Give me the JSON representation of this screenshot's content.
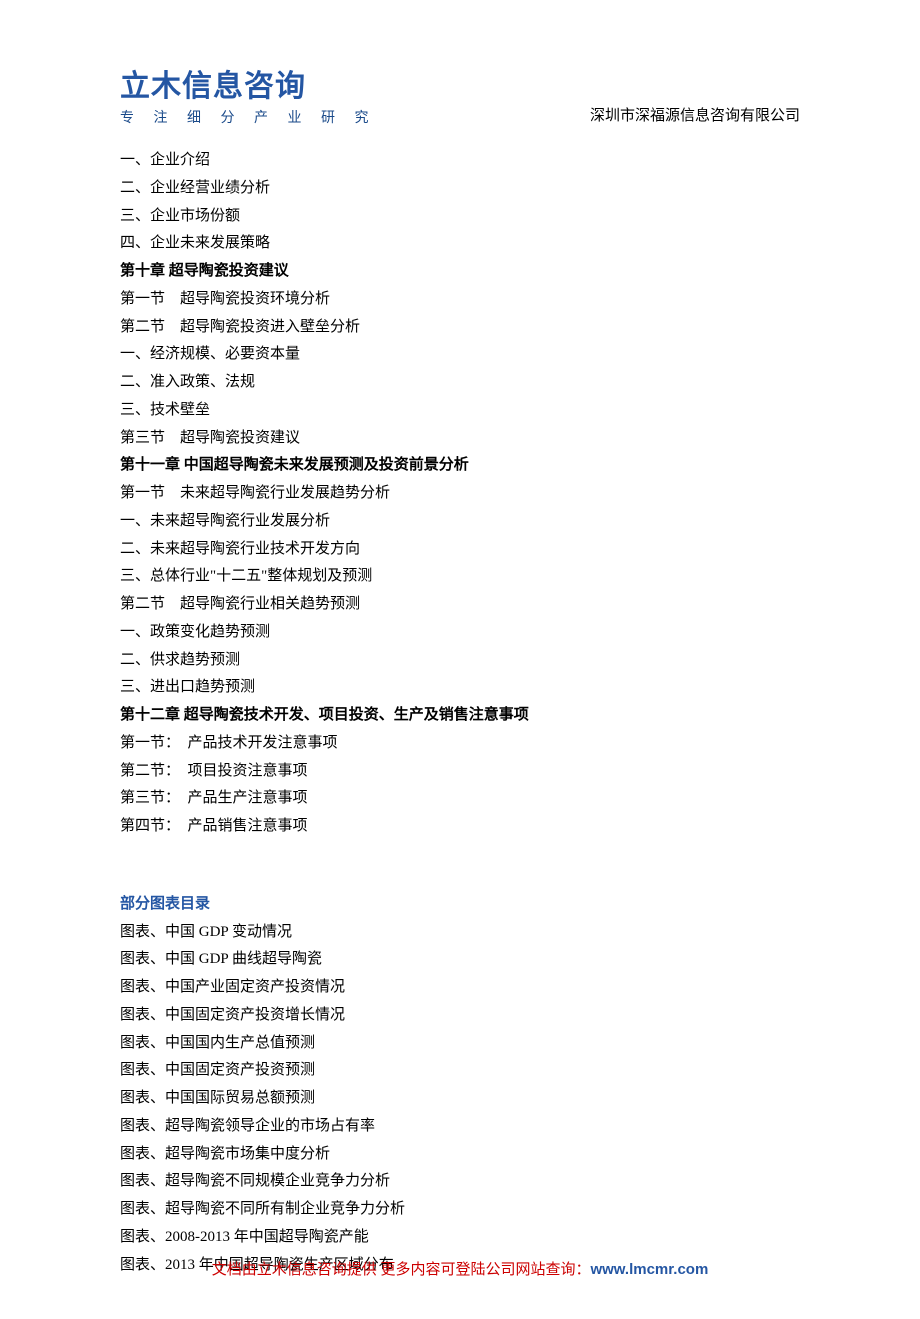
{
  "logo": {
    "main": "立木信息咨询",
    "sub": "专 注 细 分 产 业 研 究"
  },
  "company": "深圳市深福源信息咨询有限公司",
  "lines": [
    {
      "text": "一、企业介绍",
      "type": "plain"
    },
    {
      "text": "二、企业经营业绩分析",
      "type": "plain"
    },
    {
      "text": "三、企业市场份额",
      "type": "plain"
    },
    {
      "text": "四、企业未来发展策略",
      "type": "plain"
    },
    {
      "text": "第十章 超导陶瓷投资建议",
      "type": "heading"
    },
    {
      "text": "第一节　超导陶瓷投资环境分析",
      "type": "plain"
    },
    {
      "text": "第二节　超导陶瓷投资进入壁垒分析",
      "type": "plain"
    },
    {
      "text": "一、经济规模、必要资本量",
      "type": "plain"
    },
    {
      "text": "二、准入政策、法规",
      "type": "plain"
    },
    {
      "text": "三、技术壁垒",
      "type": "plain"
    },
    {
      "text": "第三节　超导陶瓷投资建议",
      "type": "plain"
    },
    {
      "text": "第十一章 中国超导陶瓷未来发展预测及投资前景分析",
      "type": "heading"
    },
    {
      "text": "第一节　未来超导陶瓷行业发展趋势分析",
      "type": "plain"
    },
    {
      "text": "一、未来超导陶瓷行业发展分析",
      "type": "plain"
    },
    {
      "text": "二、未来超导陶瓷行业技术开发方向",
      "type": "plain"
    },
    {
      "text": "三、总体行业\"十二五\"整体规划及预测",
      "type": "plain"
    },
    {
      "text": "第二节　超导陶瓷行业相关趋势预测",
      "type": "plain"
    },
    {
      "text": "一、政策变化趋势预测",
      "type": "plain"
    },
    {
      "text": "二、供求趋势预测",
      "type": "plain"
    },
    {
      "text": "三、进出口趋势预测",
      "type": "plain"
    },
    {
      "text": "第十二章 超导陶瓷技术开发、项目投资、生产及销售注意事项",
      "type": "heading"
    },
    {
      "text": "第一节：　产品技术开发注意事项",
      "type": "plain"
    },
    {
      "text": "第二节：　项目投资注意事项",
      "type": "plain"
    },
    {
      "text": "第三节：　产品生产注意事项",
      "type": "plain"
    },
    {
      "text": "第四节：　产品销售注意事项",
      "type": "plain"
    }
  ],
  "chartSection": {
    "title": "部分图表目录",
    "items": [
      "图表、中国 GDP 变动情况",
      "图表、中国 GDP 曲线超导陶瓷",
      "图表、中国产业固定资产投资情况",
      "图表、中国固定资产投资增长情况",
      "图表、中国国内生产总值预测",
      "图表、中国固定资产投资预测",
      "图表、中国国际贸易总额预测",
      "图表、超导陶瓷领导企业的市场占有率",
      "图表、超导陶瓷市场集中度分析",
      "图表、超导陶瓷不同规模企业竞争力分析",
      "图表、超导陶瓷不同所有制企业竞争力分析",
      "图表、2008-2013 年中国超导陶瓷产能",
      "图表、2013 年中国超导陶瓷生产区域分布"
    ]
  },
  "footer": {
    "text": "文档由立木信息咨询提供 更多内容可登陆公司网站查询：",
    "url": "www.lmcmr.com"
  }
}
